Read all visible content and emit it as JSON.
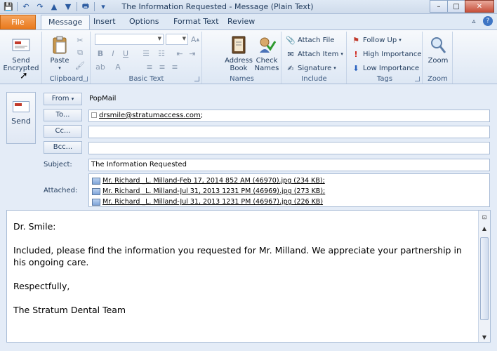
{
  "window": {
    "title": "The Information Requested  -  Message (Plain Text)",
    "minimize": "–",
    "maximize": "□",
    "close": "✕"
  },
  "qat": [
    "save-icon",
    "undo-icon",
    "redo-icon",
    "up-icon",
    "down-icon",
    "print-icon",
    "customize-icon"
  ],
  "tabs": [
    "File",
    "Message",
    "Insert",
    "Options",
    "Format Text",
    "Review"
  ],
  "ribbon": {
    "send_encrypted": {
      "line1": "Send",
      "line2": "Encrypted"
    },
    "clipboard": {
      "label": "Clipboard",
      "paste": "Paste"
    },
    "basic_text": {
      "label": "Basic Text",
      "bold": "B",
      "italic": "I",
      "underline": "U"
    },
    "names": {
      "label": "Names",
      "address_book_1": "Address",
      "address_book_2": "Book",
      "check_names_1": "Check",
      "check_names_2": "Names"
    },
    "include": {
      "label": "Include",
      "attach_file": "Attach File",
      "attach_item": "Attach Item",
      "signature": "Signature"
    },
    "tags": {
      "label": "Tags",
      "follow_up": "Follow Up",
      "high_importance": "High Importance",
      "low_importance": "Low Importance"
    },
    "zoom": {
      "label": "Zoom",
      "zoom_btn": "Zoom"
    }
  },
  "compose": {
    "send": "Send",
    "from_btn": "From",
    "from_value": "PopMail",
    "to_btn": "To...",
    "to_value": "drsmile@stratumaccess.com",
    "to_sep": ";",
    "cc_btn": "Cc...",
    "bcc_btn": "Bcc...",
    "subject_label": "Subject:",
    "subject_value": "The Information Requested",
    "attached_label": "Attached:",
    "attachments": [
      "Mr. Richard _L. Milland-Feb 17, 2014 852 AM (46970).jpg (234 KB);",
      "Mr. Richard _L. Milland-Jul 31, 2013 1231 PM (46969).jpg (273 KB);",
      "Mr. Richard _L. Milland-Jul 31, 2013 1231 PM (46967).jpg (226 KB)"
    ]
  },
  "body": {
    "greeting": "Dr. Smile:",
    "paragraph": "Included, please find the information you requested for Mr. Milland.  We appreciate your partnership in his ongoing care.",
    "closing": "Respectfully,",
    "signature": "The Stratum Dental Team"
  }
}
